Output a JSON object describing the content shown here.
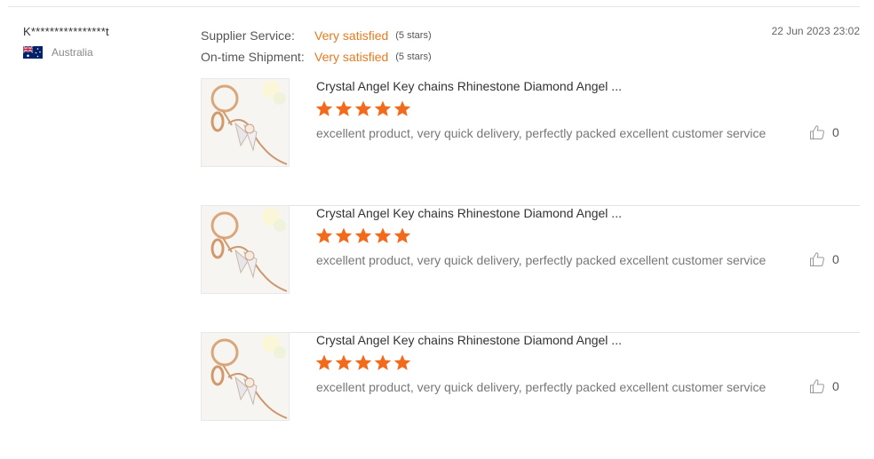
{
  "buyer": {
    "name": "K****************t",
    "country": "Australia",
    "flag_icon": "australia-flag-icon"
  },
  "ratings": [
    {
      "label": "Supplier Service:",
      "value": "Very satisfied",
      "stars": "(5 stars)"
    },
    {
      "label": "On-time Shipment:",
      "value": "Very satisfied",
      "stars": "(5 stars)"
    }
  ],
  "date": "22 Jun 2023 23:02",
  "colors": {
    "accent": "#e87a1f",
    "star": "#f26b1d"
  },
  "reviews": [
    {
      "title": "Crystal Angel Key chains Rhinestone Diamond Angel ...",
      "rating": 5,
      "comment": "excellent product, very quick delivery, perfectly packed excellent customer service",
      "helpful_count": "0"
    },
    {
      "title": "Crystal Angel Key chains Rhinestone Diamond Angel ...",
      "rating": 5,
      "comment": "excellent product, very quick delivery, perfectly packed excellent customer service",
      "helpful_count": "0"
    },
    {
      "title": "Crystal Angel Key chains Rhinestone Diamond Angel ...",
      "rating": 5,
      "comment": "excellent product, very quick delivery, perfectly packed excellent customer service",
      "helpful_count": "0"
    }
  ]
}
